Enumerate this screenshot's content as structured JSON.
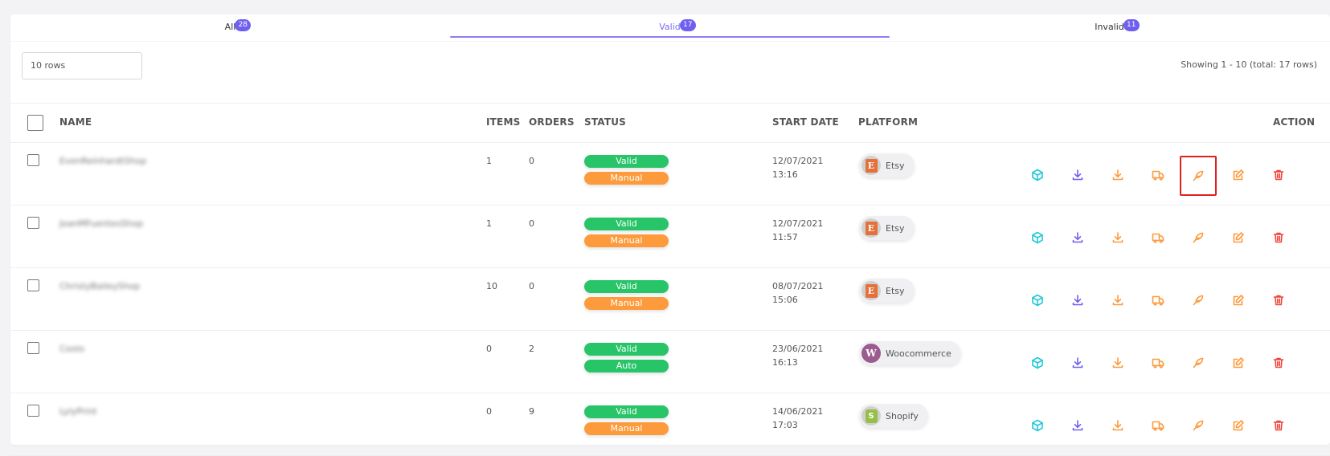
{
  "tabs": [
    {
      "label": "All",
      "count": "28"
    },
    {
      "label": "Valid",
      "count": "17"
    },
    {
      "label": "Invalid",
      "count": "11"
    }
  ],
  "controls": {
    "rows_per_page": "10 rows",
    "showing": "Showing 1 - 10 (total: 17 rows)"
  },
  "table": {
    "headers": {
      "name": "NAME",
      "items": "ITEMS",
      "orders": "ORDERS",
      "status": "STATUS",
      "start_date": "START DATE",
      "platform": "PLATFORM",
      "action": "ACTION"
    },
    "rows": [
      {
        "name": "EvenReinhardtShop",
        "items": "1",
        "orders": "0",
        "status": "Valid",
        "mode": "Manual",
        "start_date": "12/07/2021 13:16",
        "platform": "Etsy",
        "platform_icon": "etsy-icon"
      },
      {
        "name": "JoanMFuentesShop",
        "items": "1",
        "orders": "0",
        "status": "Valid",
        "mode": "Manual",
        "start_date": "12/07/2021 11:57",
        "platform": "Etsy",
        "platform_icon": "etsy-icon"
      },
      {
        "name": "ChristyBaileyShop",
        "items": "10",
        "orders": "0",
        "status": "Valid",
        "mode": "Manual",
        "start_date": "08/07/2021 15:06",
        "platform": "Etsy",
        "platform_icon": "etsy-icon"
      },
      {
        "name": "Coolo",
        "items": "0",
        "orders": "2",
        "status": "Valid",
        "mode": "Auto",
        "start_date": "23/06/2021 16:13",
        "platform": "Woocommerce",
        "platform_icon": "woocommerce-icon"
      },
      {
        "name": "LylyPrint",
        "items": "0",
        "orders": "9",
        "status": "Valid",
        "mode": "Manual",
        "start_date": "14/06/2021 17:03",
        "platform": "Shopify",
        "platform_icon": "shopify-icon"
      }
    ]
  },
  "action_icons": [
    "cube-icon",
    "download-icon",
    "import-icon",
    "truck-icon",
    "feather-icon",
    "edit-icon",
    "trash-icon"
  ],
  "colors": {
    "accent": "#6f5ff0",
    "valid": "#27c468",
    "manual": "#fd9a3c",
    "cube": "#1ec8d6",
    "download": "#6f5ff0",
    "orange": "#fd9a3c",
    "trash": "#f0443a",
    "highlight": "#e02020"
  }
}
